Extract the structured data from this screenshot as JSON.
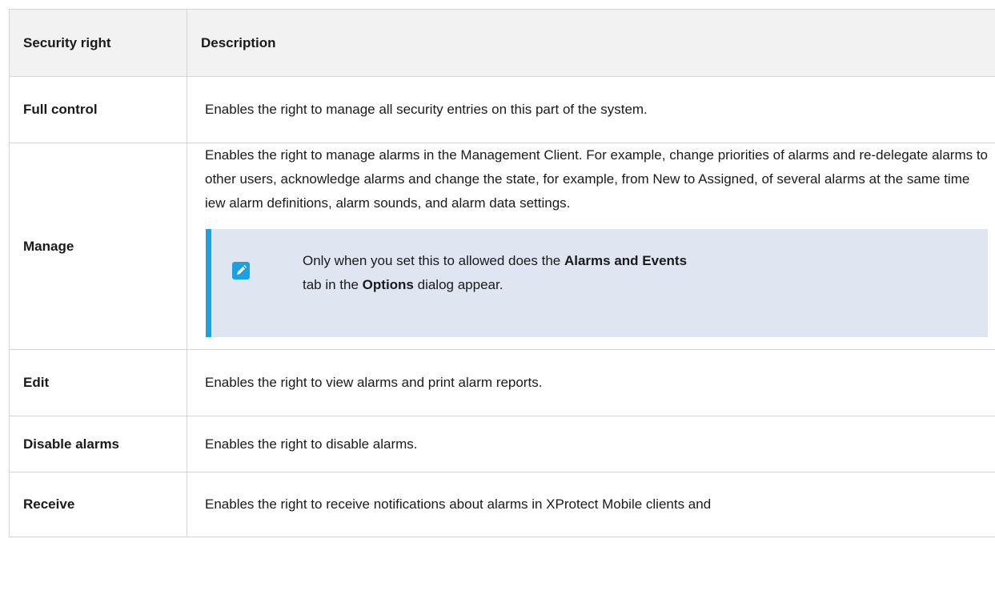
{
  "table": {
    "headers": [
      "Security right",
      "Description"
    ],
    "rows": [
      {
        "name": "Full control",
        "description": "Enables the right to manage all security entries on this part of the system."
      },
      {
        "name": "Manage",
        "description": "Enables the right to manage alarms in the Management Client. For example, change priorities of alarms and re-delegate alarms to other users, acknowledge alarms and change the state, for example, from New to Assigned, of several alarms at the same time iew alarm definitions, alarm sounds, and alarm data settings."
      },
      {
        "name": "Edit",
        "description": "Enables the right to view alarms and print alarm reports."
      },
      {
        "name": "Disable alarms",
        "description": "Enables the right to disable alarms."
      },
      {
        "name": "Receive",
        "description": "Enables the right to receive notifications about alarms in XProtect Mobile clients and"
      }
    ]
  },
  "note": {
    "icon": "pencil-icon",
    "line1_before": "Only when you set this to allowed does the ",
    "line1_bold": "Alarms and Events",
    "line2_before": "tab in the ",
    "line2_bold": "Options",
    "line2_after": " dialog appear."
  },
  "colors": {
    "note_background": "#dfe6f2",
    "note_accent": "#1ba1e2",
    "header_background": "#f2f2f2",
    "border": "#d4d4d4"
  }
}
